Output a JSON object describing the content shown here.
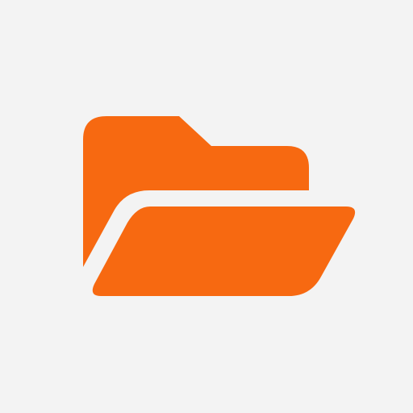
{
  "app_icon": {
    "name": "open-folder",
    "background_color": "#f3f3f3",
    "accent_color": "#f76911"
  }
}
